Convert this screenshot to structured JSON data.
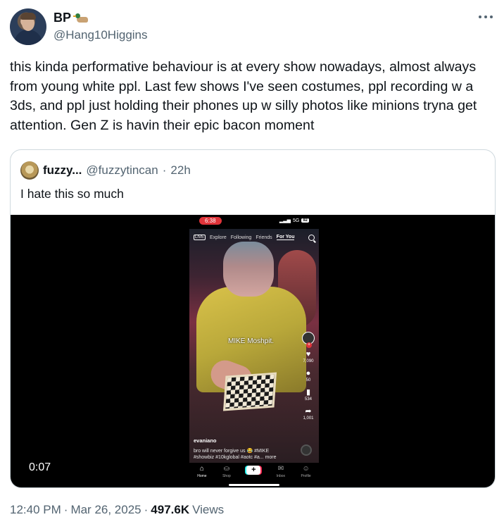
{
  "tweet": {
    "display_name": "BP",
    "badge_icon": "duck-emoji",
    "handle": "@Hang10Higgins",
    "text": "this kinda performative behaviour is at every show nowadays, almost always from young white ppl. Last few shows I've seen costumes, ppl recording w a 3ds, and ppl just holding their phones up w silly photos like minions tryna get attention. Gen Z is havin their epic bacon moment",
    "time": "12:40 PM",
    "date": "Mar 26, 2025",
    "views_count": "497.6K",
    "views_label": "Views",
    "separator": "·"
  },
  "quote": {
    "display_name": "fuzzy...",
    "handle": "@fuzzytincan",
    "separator": "·",
    "time": "22h",
    "text": "I hate this so much",
    "video_duration": "0:07"
  },
  "phone": {
    "status_time": "6:38",
    "network": "5G",
    "battery": "92",
    "nav_tabs": [
      "Explore",
      "Following",
      "Friends",
      "For You"
    ],
    "live_label": "LIVE",
    "overlay_text": "MIKE Moshpit.",
    "rail": {
      "likes": "7,090",
      "comments": "50",
      "saves": "534",
      "shares": "1,001"
    },
    "caption_user": "evaniano",
    "caption_line1": "bro will never forgive us 😂 #MIKE",
    "caption_line2": "#showbiz #10kglobal #aotc #a... more",
    "bottom_nav": {
      "home": "Home",
      "shop": "Shop",
      "inbox": "Inbox",
      "profile": "Profile"
    }
  },
  "colors": {
    "text_primary": "#0f1419",
    "text_secondary": "#536471",
    "border": "#cfd9de",
    "tiktok_red": "#e0343a"
  }
}
